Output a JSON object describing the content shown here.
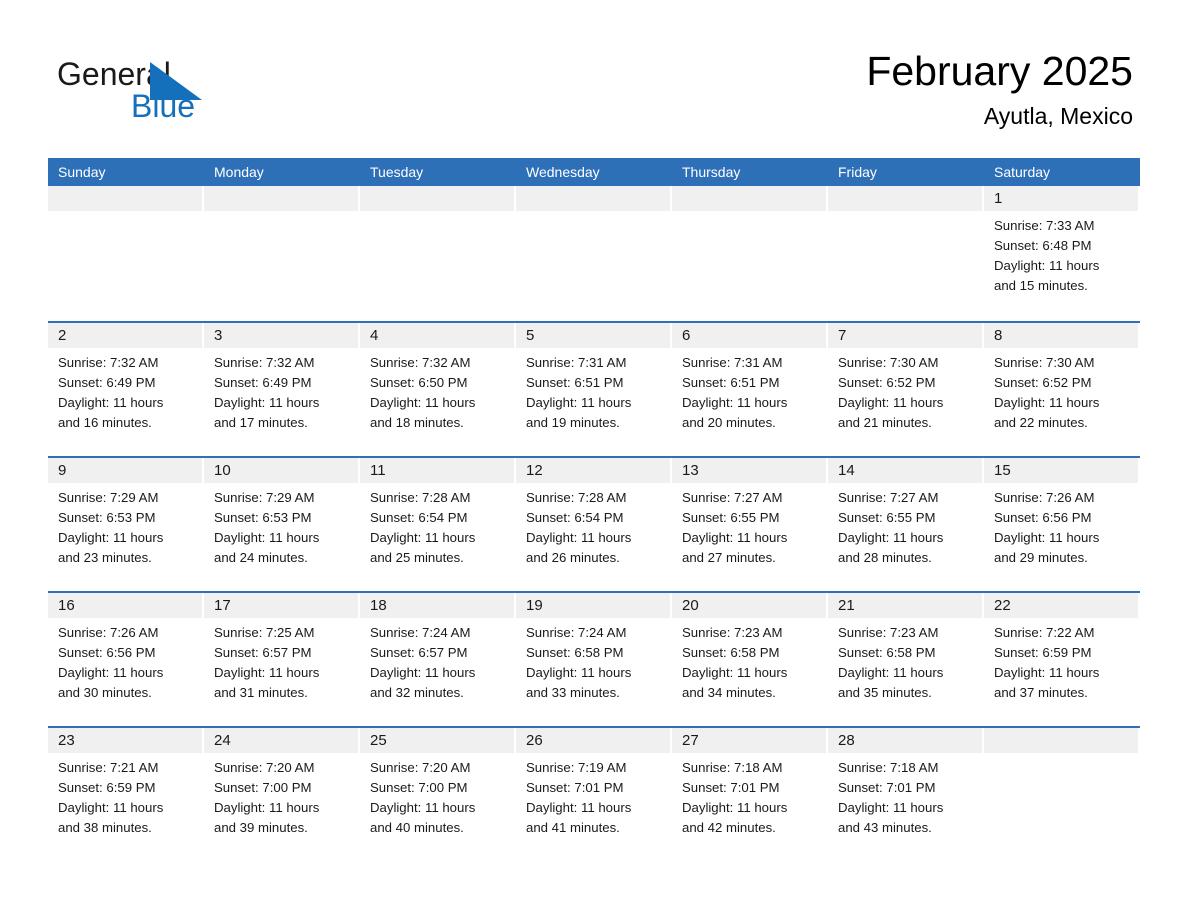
{
  "brand": {
    "line1": "General",
    "line2": "Blue",
    "triangle_color": "#1570bc",
    "text_color": "#1a1a1a"
  },
  "header": {
    "title": "February 2025",
    "subtitle": "Ayutla, Mexico"
  },
  "colors": {
    "header_blue": "#2e70b8",
    "row_separator": "#2e70b8",
    "datebar_gray": "#f0f0f0",
    "page_background": "#ffffff",
    "text": "#1a1a1a"
  },
  "calendar": {
    "weekday_headers": [
      "Sunday",
      "Monday",
      "Tuesday",
      "Wednesday",
      "Thursday",
      "Friday",
      "Saturday"
    ],
    "weeks": [
      [
        {
          "day": "",
          "empty": true
        },
        {
          "day": "",
          "empty": true
        },
        {
          "day": "",
          "empty": true
        },
        {
          "day": "",
          "empty": true
        },
        {
          "day": "",
          "empty": true
        },
        {
          "day": "",
          "empty": true
        },
        {
          "day": "1",
          "sunrise": "Sunrise: 7:33 AM",
          "sunset": "Sunset: 6:48 PM",
          "daylight1": "Daylight: 11 hours",
          "daylight2": "and 15 minutes."
        }
      ],
      [
        {
          "day": "2",
          "sunrise": "Sunrise: 7:32 AM",
          "sunset": "Sunset: 6:49 PM",
          "daylight1": "Daylight: 11 hours",
          "daylight2": "and 16 minutes."
        },
        {
          "day": "3",
          "sunrise": "Sunrise: 7:32 AM",
          "sunset": "Sunset: 6:49 PM",
          "daylight1": "Daylight: 11 hours",
          "daylight2": "and 17 minutes."
        },
        {
          "day": "4",
          "sunrise": "Sunrise: 7:32 AM",
          "sunset": "Sunset: 6:50 PM",
          "daylight1": "Daylight: 11 hours",
          "daylight2": "and 18 minutes."
        },
        {
          "day": "5",
          "sunrise": "Sunrise: 7:31 AM",
          "sunset": "Sunset: 6:51 PM",
          "daylight1": "Daylight: 11 hours",
          "daylight2": "and 19 minutes."
        },
        {
          "day": "6",
          "sunrise": "Sunrise: 7:31 AM",
          "sunset": "Sunset: 6:51 PM",
          "daylight1": "Daylight: 11 hours",
          "daylight2": "and 20 minutes."
        },
        {
          "day": "7",
          "sunrise": "Sunrise: 7:30 AM",
          "sunset": "Sunset: 6:52 PM",
          "daylight1": "Daylight: 11 hours",
          "daylight2": "and 21 minutes."
        },
        {
          "day": "8",
          "sunrise": "Sunrise: 7:30 AM",
          "sunset": "Sunset: 6:52 PM",
          "daylight1": "Daylight: 11 hours",
          "daylight2": "and 22 minutes."
        }
      ],
      [
        {
          "day": "9",
          "sunrise": "Sunrise: 7:29 AM",
          "sunset": "Sunset: 6:53 PM",
          "daylight1": "Daylight: 11 hours",
          "daylight2": "and 23 minutes."
        },
        {
          "day": "10",
          "sunrise": "Sunrise: 7:29 AM",
          "sunset": "Sunset: 6:53 PM",
          "daylight1": "Daylight: 11 hours",
          "daylight2": "and 24 minutes."
        },
        {
          "day": "11",
          "sunrise": "Sunrise: 7:28 AM",
          "sunset": "Sunset: 6:54 PM",
          "daylight1": "Daylight: 11 hours",
          "daylight2": "and 25 minutes."
        },
        {
          "day": "12",
          "sunrise": "Sunrise: 7:28 AM",
          "sunset": "Sunset: 6:54 PM",
          "daylight1": "Daylight: 11 hours",
          "daylight2": "and 26 minutes."
        },
        {
          "day": "13",
          "sunrise": "Sunrise: 7:27 AM",
          "sunset": "Sunset: 6:55 PM",
          "daylight1": "Daylight: 11 hours",
          "daylight2": "and 27 minutes."
        },
        {
          "day": "14",
          "sunrise": "Sunrise: 7:27 AM",
          "sunset": "Sunset: 6:55 PM",
          "daylight1": "Daylight: 11 hours",
          "daylight2": "and 28 minutes."
        },
        {
          "day": "15",
          "sunrise": "Sunrise: 7:26 AM",
          "sunset": "Sunset: 6:56 PM",
          "daylight1": "Daylight: 11 hours",
          "daylight2": "and 29 minutes."
        }
      ],
      [
        {
          "day": "16",
          "sunrise": "Sunrise: 7:26 AM",
          "sunset": "Sunset: 6:56 PM",
          "daylight1": "Daylight: 11 hours",
          "daylight2": "and 30 minutes."
        },
        {
          "day": "17",
          "sunrise": "Sunrise: 7:25 AM",
          "sunset": "Sunset: 6:57 PM",
          "daylight1": "Daylight: 11 hours",
          "daylight2": "and 31 minutes."
        },
        {
          "day": "18",
          "sunrise": "Sunrise: 7:24 AM",
          "sunset": "Sunset: 6:57 PM",
          "daylight1": "Daylight: 11 hours",
          "daylight2": "and 32 minutes."
        },
        {
          "day": "19",
          "sunrise": "Sunrise: 7:24 AM",
          "sunset": "Sunset: 6:58 PM",
          "daylight1": "Daylight: 11 hours",
          "daylight2": "and 33 minutes."
        },
        {
          "day": "20",
          "sunrise": "Sunrise: 7:23 AM",
          "sunset": "Sunset: 6:58 PM",
          "daylight1": "Daylight: 11 hours",
          "daylight2": "and 34 minutes."
        },
        {
          "day": "21",
          "sunrise": "Sunrise: 7:23 AM",
          "sunset": "Sunset: 6:58 PM",
          "daylight1": "Daylight: 11 hours",
          "daylight2": "and 35 minutes."
        },
        {
          "day": "22",
          "sunrise": "Sunrise: 7:22 AM",
          "sunset": "Sunset: 6:59 PM",
          "daylight1": "Daylight: 11 hours",
          "daylight2": "and 37 minutes."
        }
      ],
      [
        {
          "day": "23",
          "sunrise": "Sunrise: 7:21 AM",
          "sunset": "Sunset: 6:59 PM",
          "daylight1": "Daylight: 11 hours",
          "daylight2": "and 38 minutes."
        },
        {
          "day": "24",
          "sunrise": "Sunrise: 7:20 AM",
          "sunset": "Sunset: 7:00 PM",
          "daylight1": "Daylight: 11 hours",
          "daylight2": "and 39 minutes."
        },
        {
          "day": "25",
          "sunrise": "Sunrise: 7:20 AM",
          "sunset": "Sunset: 7:00 PM",
          "daylight1": "Daylight: 11 hours",
          "daylight2": "and 40 minutes."
        },
        {
          "day": "26",
          "sunrise": "Sunrise: 7:19 AM",
          "sunset": "Sunset: 7:01 PM",
          "daylight1": "Daylight: 11 hours",
          "daylight2": "and 41 minutes."
        },
        {
          "day": "27",
          "sunrise": "Sunrise: 7:18 AM",
          "sunset": "Sunset: 7:01 PM",
          "daylight1": "Daylight: 11 hours",
          "daylight2": "and 42 minutes."
        },
        {
          "day": "28",
          "sunrise": "Sunrise: 7:18 AM",
          "sunset": "Sunset: 7:01 PM",
          "daylight1": "Daylight: 11 hours",
          "daylight2": "and 43 minutes."
        },
        {
          "day": "",
          "empty": true
        }
      ]
    ]
  }
}
